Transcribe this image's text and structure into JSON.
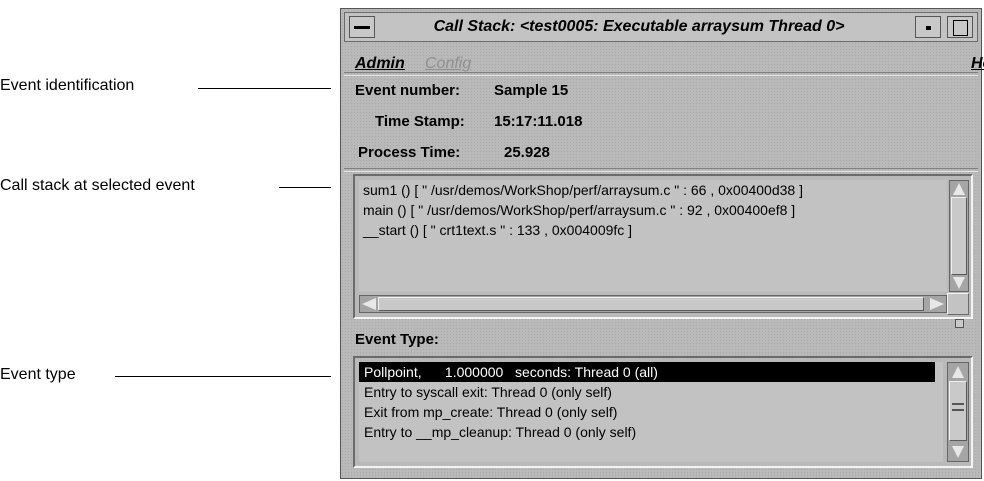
{
  "callouts": {
    "event_identification": "Event identification",
    "call_stack": "Call stack at selected event",
    "event_type": "Event type"
  },
  "window": {
    "title": "Call Stack: <test0005: Executable arraysum Thread 0>"
  },
  "menubar": {
    "admin_label": "Admin",
    "config_label": "Config",
    "help_label": "Help"
  },
  "event_info": {
    "event_number_label": "Event number:",
    "event_number_value": "Sample 15",
    "time_stamp_label": "Time Stamp:",
    "time_stamp_value": "15:17:11.018",
    "process_time_label": "Process Time:",
    "process_time_value": "25.928"
  },
  "call_stack": {
    "lines": [
      "sum1 () [ \" /usr/demos/WorkShop/perf/arraysum.c \" : 66 , 0x00400d38 ]",
      "main () [ \" /usr/demos/WorkShop/perf/arraysum.c \" : 92 , 0x00400ef8 ]",
      "__start () [ \" crt1text.s \" : 133 , 0x004009fc ]"
    ]
  },
  "event_type": {
    "label": "Event Type:",
    "items": [
      "Pollpoint,      1.000000   seconds: Thread 0 (all)",
      "Entry to syscall exit: Thread 0 (only self)",
      "Exit from mp_create: Thread 0 (only self)",
      "Entry to __mp_cleanup: Thread 0 (only self)"
    ],
    "selected_index": 0
  },
  "icons": {
    "window_menu": "window-menu-icon",
    "minimize": "minimize-icon",
    "maximize": "maximize-icon",
    "scroll_up": "arrow-up-icon",
    "scroll_down": "arrow-down-icon",
    "scroll_left": "arrow-left-icon",
    "scroll_right": "arrow-right-icon"
  },
  "colors": {
    "window_bg": "#b9b9b9",
    "selection_bg": "#000000",
    "selection_fg": "#ffffff",
    "disabled_menu": "#8f8f8f"
  }
}
